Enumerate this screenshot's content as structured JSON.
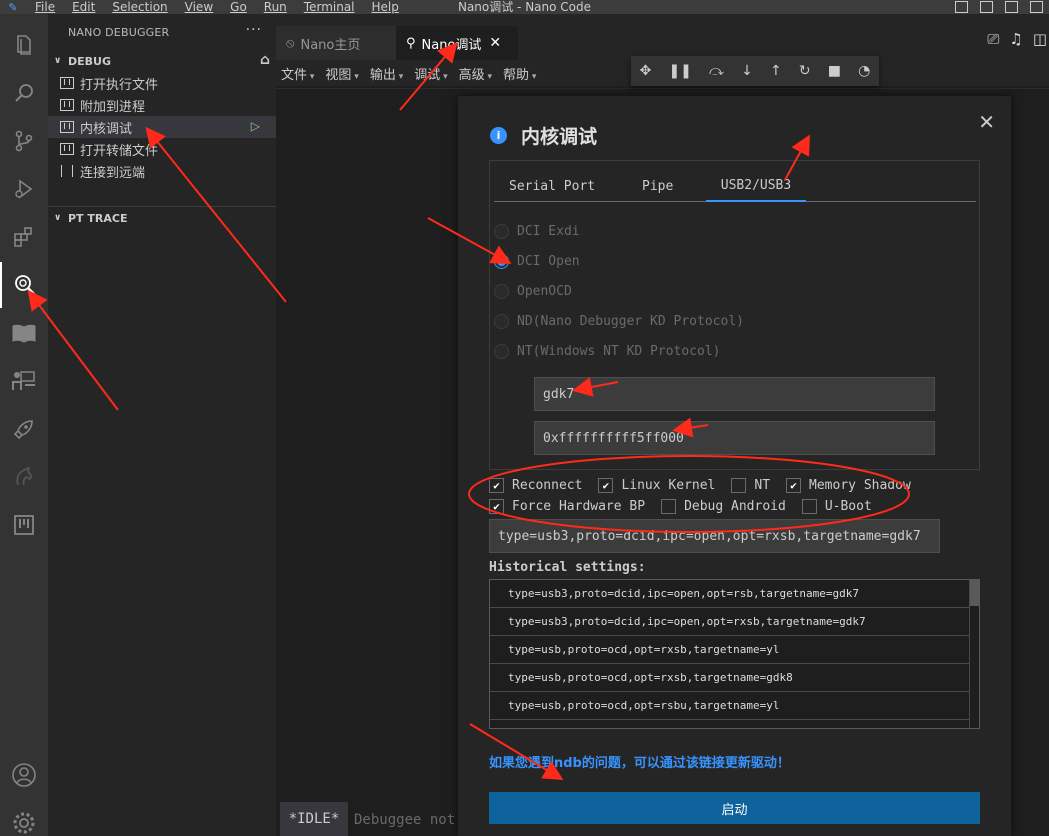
{
  "titlebar": {
    "menu": [
      "File",
      "Edit",
      "Selection",
      "View",
      "Go",
      "Run",
      "Terminal",
      "Help"
    ],
    "title": "Nano调试 - Nano Code"
  },
  "activity": {
    "icons": [
      "files-icon",
      "search-icon",
      "source-control-icon",
      "run-debug-icon",
      "extensions-icon",
      "nano-debugger-icon",
      "book-icon",
      "presenter-icon",
      "rocket-icon",
      "horse-icon",
      "board-icon"
    ],
    "bottom": [
      "account-icon",
      "settings-gear-icon"
    ]
  },
  "sidebar": {
    "title": "NANO DEBUGGER",
    "more": "···",
    "debug_section": "DEBUG",
    "items": [
      {
        "label": "打开执行文件"
      },
      {
        "label": "附加到进程"
      },
      {
        "label": "内核调试"
      },
      {
        "label": "打开转储文件"
      },
      {
        "label": "连接到远端"
      }
    ],
    "pt_section": "PT TRACE"
  },
  "tabs": [
    {
      "label": "Nano主页"
    },
    {
      "label": "Nano调试",
      "close": "✕"
    }
  ],
  "editor_menu": [
    "文件",
    "视图",
    "输出",
    "调试",
    "高级",
    "帮助"
  ],
  "status": {
    "idle": "*IDLE*",
    "text": "Debuggee not"
  },
  "dialog": {
    "title": "内核调试",
    "close": "✕",
    "tabs": [
      "Serial Port",
      "Pipe",
      "USB2/USB3"
    ],
    "active_tab": "USB2/USB3",
    "radios": [
      {
        "label": "DCI Exdi",
        "checked": false
      },
      {
        "label": "DCI Open",
        "checked": true
      },
      {
        "label": "OpenOCD",
        "checked": false
      },
      {
        "label": "ND(Nano Debugger KD Protocol)",
        "checked": false
      },
      {
        "label": "NT(Windows NT KD Protocol)",
        "checked": false
      }
    ],
    "target_name": "gdk7",
    "address": "0xffffffffff5ff000",
    "checks_row1": [
      {
        "label": "Reconnect",
        "checked": true
      },
      {
        "label": "Linux Kernel",
        "checked": true
      },
      {
        "label": "NT",
        "checked": false
      },
      {
        "label": "Memory Shadow",
        "checked": true
      }
    ],
    "checks_row2": [
      {
        "label": "Force Hardware BP",
        "checked": true
      },
      {
        "label": "Debug Android",
        "checked": false
      },
      {
        "label": "U-Boot",
        "checked": false
      }
    ],
    "command": "type=usb3,proto=dcid,ipc=open,opt=rxsb,targetname=gdk7",
    "history_label": "Historical settings:",
    "history": [
      "type=usb3,proto=dcid,ipc=open,opt=rsb,targetname=gdk7",
      "type=usb3,proto=dcid,ipc=open,opt=rxsb,targetname=gdk7",
      "type=usb,proto=ocd,opt=rxsb,targetname=yl",
      "type=usb,proto=ocd,opt=rxsb,targetname=gdk8",
      "type=usb,proto=ocd,opt=rsbu,targetname=yl"
    ],
    "link": "如果您遇到ndb的问题，可以通过该链接更新驱动！",
    "start": "启动"
  },
  "colors": {
    "accent": "#3794ff",
    "button": "#0e639c",
    "annotation": "#ff2a1a"
  }
}
